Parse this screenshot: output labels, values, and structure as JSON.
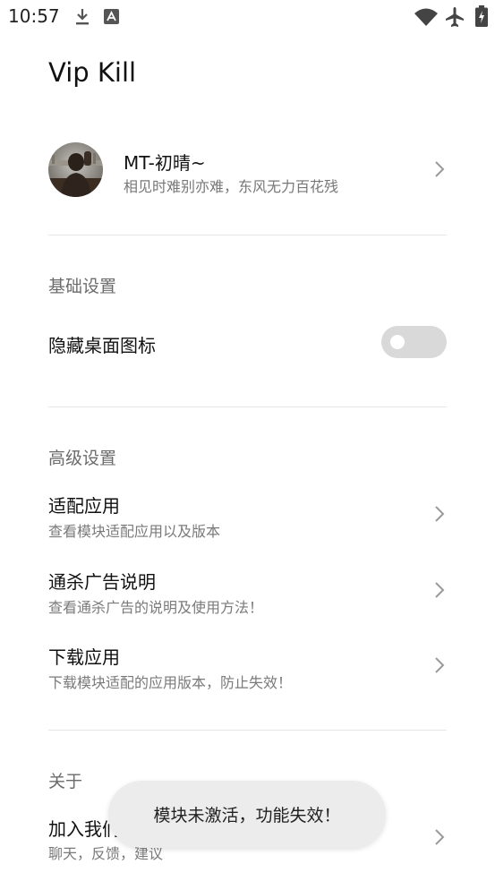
{
  "status_bar": {
    "time": "10:57",
    "icons": [
      "download-icon",
      "font-icon",
      "wifi-icon",
      "airplane-icon",
      "battery-charging-icon"
    ]
  },
  "app": {
    "title": "Vip Kill"
  },
  "profile": {
    "name": "MT-初晴~",
    "motto": "相见时难别亦难，东风无力百花残"
  },
  "sections": {
    "basic": {
      "header": "基础设置",
      "hide_icon": {
        "title": "隐藏桌面图标",
        "enabled": false
      }
    },
    "advanced": {
      "header": "高级设置",
      "items": [
        {
          "title": "适配应用",
          "subtitle": "查看模块适配应用以及版本"
        },
        {
          "title": "通杀广告说明",
          "subtitle": "查看通杀广告的说明及使用方法！"
        },
        {
          "title": "下载应用",
          "subtitle": "下载模块适配的应用版本，防止失效！"
        }
      ]
    },
    "about": {
      "header": "关于",
      "items": [
        {
          "title": "加入我们",
          "subtitle": "聊天，反馈，建议"
        }
      ]
    }
  },
  "toast": {
    "message": "模块未激活，功能失效！"
  },
  "colors": {
    "toggle_off": "#d9d9d9",
    "toast_bg": "#ececec",
    "divider": "#e6e6e6"
  }
}
